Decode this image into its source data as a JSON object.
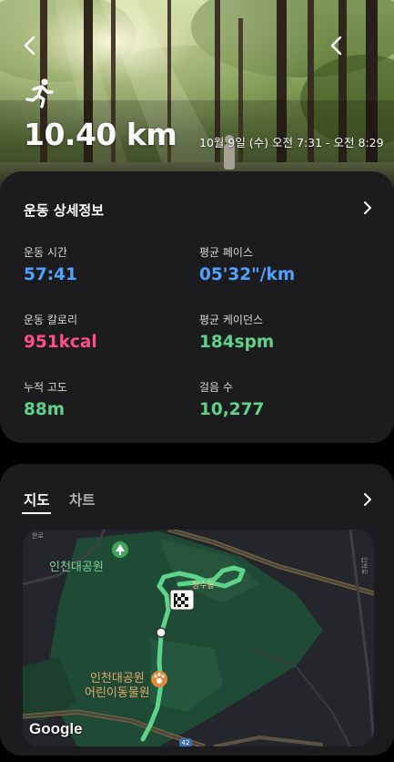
{
  "header": {
    "distance": "10.40 km",
    "datetime": "10월 9일 (수) 오전 7:31 - 오전 8:29"
  },
  "details": {
    "title": "운동 상세정보",
    "stats": [
      {
        "label": "운동 시간",
        "value": "57:41",
        "unit": "",
        "color": "#4ea3ff"
      },
      {
        "label": "평균 페이스",
        "value": "05'32\"/km",
        "unit": "",
        "color": "#4ea3ff"
      },
      {
        "label": "운동 칼로리",
        "value": "951",
        "unit": "kcal",
        "color": "#ff4f8b"
      },
      {
        "label": "평균 케이던스",
        "value": "184",
        "unit": "spm",
        "color": "#5ed38a"
      },
      {
        "label": "누적 고도",
        "value": "88",
        "unit": "m",
        "color": "#5ed38a"
      },
      {
        "label": "걸음 수",
        "value": "10,277",
        "unit": "",
        "color": "#5ed38a"
      }
    ]
  },
  "map_section": {
    "tabs": [
      {
        "label": "지도",
        "active": true
      },
      {
        "label": "차트",
        "active": false
      }
    ],
    "labels": {
      "park_north": "인천대공원",
      "area": "장수동",
      "zoo_line1": "인천대공원",
      "zoo_line2": "어린이동물원",
      "road_number": "42",
      "side_road": "한로",
      "side_road2": "입학로"
    },
    "attribution": "Google",
    "route_color": "#5ed38a"
  },
  "icons": {
    "back": "chevron-left-icon",
    "share": "share-icon",
    "activity": "running-icon",
    "details_more": "chevron-right-icon",
    "map_more": "chevron-right-icon",
    "park_marker": "tree-marker-icon",
    "zoo_marker": "paw-marker-icon",
    "finish": "checkered-flag-icon"
  }
}
